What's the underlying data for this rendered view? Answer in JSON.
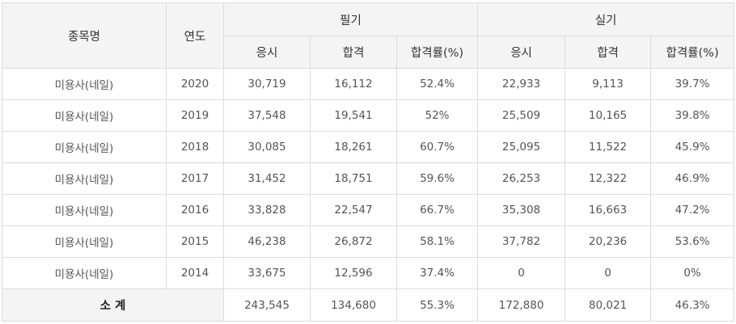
{
  "header": {
    "item_label": "종목명",
    "year_label": "연도",
    "written_label": "필기",
    "practical_label": "실기",
    "sub_columns": [
      "응시",
      "합격",
      "합격률(%)",
      "응시",
      "합격",
      "합격률(%)"
    ]
  },
  "rows": [
    {
      "name": "미용사(네일)",
      "year": "2020",
      "w_apply": "30,719",
      "w_pass": "16,112",
      "w_rate": "52.4%",
      "p_apply": "22,933",
      "p_pass": "9,113",
      "p_rate": "39.7%"
    },
    {
      "name": "미용사(네일)",
      "year": "2019",
      "w_apply": "37,548",
      "w_pass": "19,541",
      "w_rate": "52%",
      "p_apply": "25,509",
      "p_pass": "10,165",
      "p_rate": "39.8%"
    },
    {
      "name": "미용사(네일)",
      "year": "2018",
      "w_apply": "30,085",
      "w_pass": "18,261",
      "w_rate": "60.7%",
      "p_apply": "25,095",
      "p_pass": "11,522",
      "p_rate": "45.9%"
    },
    {
      "name": "미용사(네일)",
      "year": "2017",
      "w_apply": "31,452",
      "w_pass": "18,751",
      "w_rate": "59.6%",
      "p_apply": "26,253",
      "p_pass": "12,322",
      "p_rate": "46.9%"
    },
    {
      "name": "미용사(네일)",
      "year": "2016",
      "w_apply": "33,828",
      "w_pass": "22,547",
      "w_rate": "66.7%",
      "p_apply": "35,308",
      "p_pass": "16,663",
      "p_rate": "47.2%"
    },
    {
      "name": "미용사(네일)",
      "year": "2015",
      "w_apply": "46,238",
      "w_pass": "26,872",
      "w_rate": "58.1%",
      "p_apply": "37,782",
      "p_pass": "20,236",
      "p_rate": "53.6%"
    },
    {
      "name": "미용사(네일)",
      "year": "2014",
      "w_apply": "33,675",
      "w_pass": "12,596",
      "w_rate": "37.4%",
      "p_apply": "0",
      "p_pass": "0",
      "p_rate": "0%"
    }
  ],
  "total": {
    "label": "소 계",
    "w_apply": "243,545",
    "w_pass": "134,680",
    "w_rate": "55.3%",
    "p_apply": "172,880",
    "p_pass": "80,021",
    "p_rate": "46.3%"
  }
}
